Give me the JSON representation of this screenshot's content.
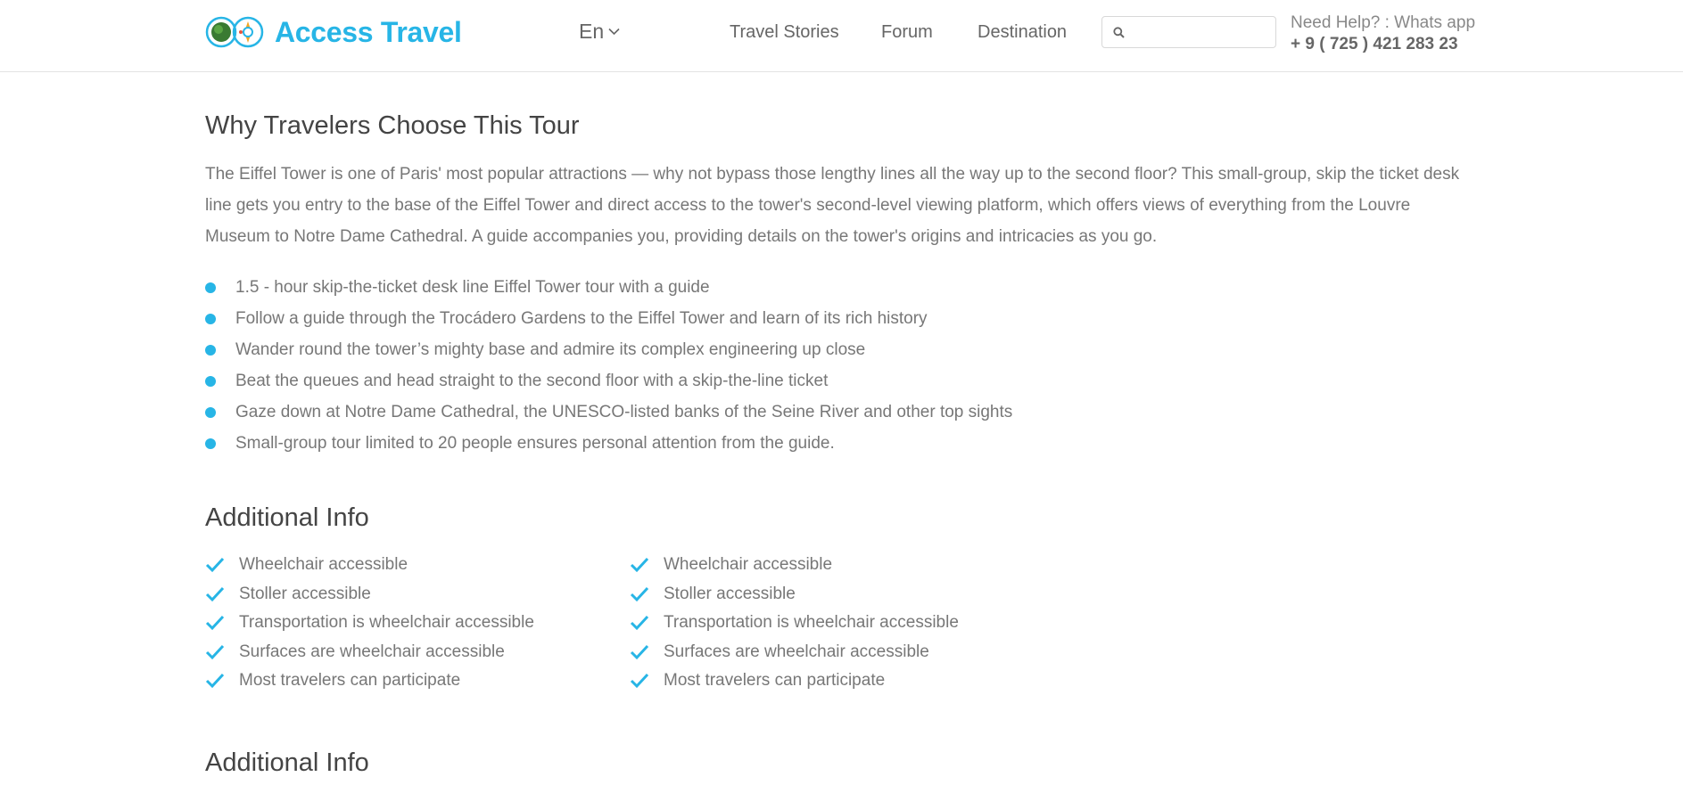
{
  "header": {
    "brand": "Access Travel",
    "language": "En",
    "nav": [
      "Travel Stories",
      "Forum",
      "Destination"
    ],
    "search_value": "",
    "help_label": "Need Help? : Whats app",
    "phone": "+ 9 ( 725 ) 421 283 23",
    "accent_color": "#27b5e6",
    "logo_icon": "globe-and-compass-icon",
    "search_icon": "search-icon",
    "language_chevron_icon": "chevron-down-icon"
  },
  "tour": {
    "heading": "Why Travelers Choose This Tour",
    "description": "The Eiffel Tower is one of Paris' most popular attractions — why not bypass those lengthy lines all the way up to the second floor? This small-group, skip the ticket desk line gets you entry to the base of the Eiffel Tower and direct access to the tower's second-level viewing platform, which offers views of everything from the Louvre Museum to Notre Dame Cathedral. A guide accompanies you, providing details on the tower's origins and intricacies as you go.",
    "highlights": [
      "1.5 - hour skip-the-ticket desk line Eiffel Tower tour with a guide",
      "Follow a guide through the Trocádero Gardens to the Eiffel Tower and learn of its rich history",
      "Wander round the tower’s mighty base and admire its complex engineering up close",
      "Beat the queues and head straight to the second floor with a skip-the-line ticket",
      "Gaze down at Notre Dame Cathedral, the UNESCO-listed banks of the Seine River and other top sights",
      "Small-group tour limited to 20 people ensures personal attention from the guide."
    ]
  },
  "additional_info": {
    "heading": "Additional Info",
    "column_left": [
      "Wheelchair accessible",
      "Stoller accessible",
      "Transportation is wheelchair accessible",
      "Surfaces are wheelchair accessible",
      "Most travelers can participate"
    ],
    "column_right": [
      "Wheelchair accessible",
      "Stoller accessible",
      "Transportation is wheelchair accessible",
      "Surfaces are wheelchair accessible",
      "Most travelers can participate"
    ],
    "check_icon": "check-icon"
  },
  "additional_info_2": {
    "heading": "Additional Info"
  }
}
